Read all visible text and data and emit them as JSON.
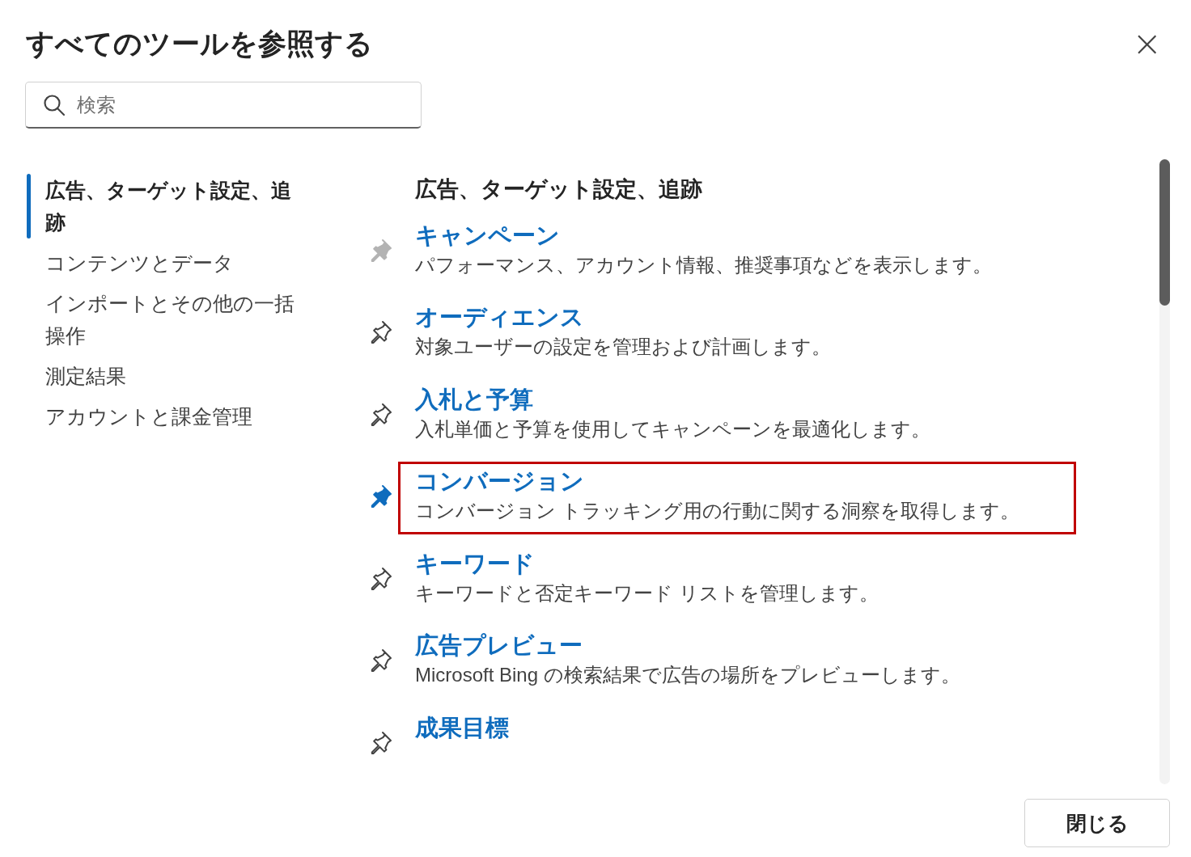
{
  "dialog": {
    "title": "すべてのツールを参照する",
    "close_label": "×"
  },
  "search": {
    "placeholder": "検索"
  },
  "sidebar": {
    "items": [
      {
        "label": "広告、ターゲット設定、追跡",
        "selected": true
      },
      {
        "label": "コンテンツとデータ",
        "selected": false
      },
      {
        "label": "インポートとその他の一括操作",
        "selected": false
      },
      {
        "label": "測定結果",
        "selected": false
      },
      {
        "label": "アカウントと課金管理",
        "selected": false
      }
    ]
  },
  "section": {
    "heading": "広告、ターゲット設定、追跡",
    "tools": [
      {
        "title": "キャンペーン",
        "description": "パフォーマンス、アカウント情報、推奨事項などを表示します。",
        "pinned": true,
        "disabled": true,
        "highlighted": false
      },
      {
        "title": "オーディエンス",
        "description": "対象ユーザーの設定を管理および計画します。",
        "pinned": false,
        "disabled": false,
        "highlighted": false
      },
      {
        "title": "入札と予算",
        "description": "入札単価と予算を使用してキャンペーンを最適化します。",
        "pinned": false,
        "disabled": false,
        "highlighted": false
      },
      {
        "title": "コンバージョン",
        "description": "コンバージョン トラッキング用の行動に関する洞察を取得します。",
        "pinned": true,
        "disabled": false,
        "highlighted": true
      },
      {
        "title": "キーワード",
        "description": "キーワードと否定キーワード リストを管理します。",
        "pinned": false,
        "disabled": false,
        "highlighted": false
      },
      {
        "title": "広告プレビュー",
        "description": "Microsoft Bing の検索結果で広告の場所をプレビューします。",
        "pinned": false,
        "disabled": false,
        "highlighted": false
      },
      {
        "title": "成果目標",
        "pinned": false,
        "disabled": false,
        "highlighted": false
      }
    ]
  },
  "footer": {
    "buttons": [
      "閉じる"
    ]
  }
}
